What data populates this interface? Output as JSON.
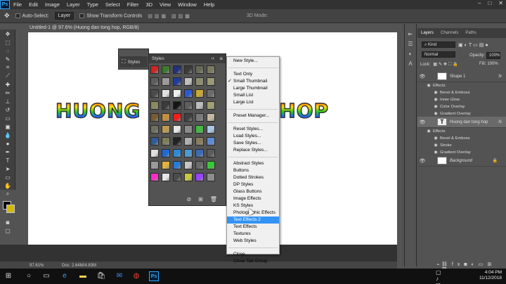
{
  "app": {
    "logo": "Ps"
  },
  "menubar": {
    "items": [
      "File",
      "Edit",
      "Image",
      "Layer",
      "Type",
      "Select",
      "Filter",
      "3D",
      "View",
      "Window",
      "Help"
    ]
  },
  "options": {
    "auto_select": "Auto-Select:",
    "auto_select_value": "Layer",
    "transform": "Show Transform Controls",
    "mode_label": "3D Mode:"
  },
  "document": {
    "tab": "Untitled-1 @ 97.6% (Huong dan tong hop, RGB/8) *",
    "headline": "HUONG DAN TONG HOP"
  },
  "status": {
    "zoom": "97.61%",
    "doc": "Doc: 2.64M/4.83M"
  },
  "styles_panel": {
    "title": "Styles",
    "mini_title": "Styles",
    "swatch_colors": [
      "#d52222",
      "#3a7a2e",
      "#23307a",
      "#3b3b3b",
      "#666b55",
      "#7a7a5c",
      "#5e5e5e",
      "#9b9b9b",
      "#1f3e9a",
      "#c0c0c0",
      "#8d8d6d",
      "#9a9a74",
      "#4a4a4a",
      "#e0e0e0",
      "#f0f0f0",
      "#2a5bd6",
      "#c8a833",
      "#6c6c6c",
      "#8a8a5e",
      "#3b3b3b",
      "#151515",
      "#5d5d5d",
      "#bdbdbd",
      "#a0a070",
      "#7b5a2f",
      "#c68d3f",
      "#ef1d1d",
      "#404040",
      "#7a7a7a",
      "#c4b9a0",
      "#707060",
      "#bd9b55",
      "#e6e6e6",
      "#8b8b8b",
      "#42b942",
      "#a8c8e8",
      "#2f5a9c",
      "#7e7e5c",
      "#222222",
      "#b0b0b0",
      "#8a7d5c",
      "#5d8ad6",
      "#e0e0e0",
      "#1d6ad6",
      "#2a8ad6",
      "#4a9ad6",
      "#3c6bb5",
      "#5b5b5b",
      "#9a9a9a",
      "#e0b33a",
      "#2a7ad6",
      "#c6c6c6",
      "#6a6a6a",
      "#34ca34",
      "#ff2bc9",
      "#e6e6e6",
      "#4b4b4b",
      "#c9c93a",
      "#9a44ff",
      "#8d8d8d"
    ]
  },
  "menu": {
    "items": [
      {
        "label": "New Style...",
        "sep_after": true
      },
      {
        "label": "Text Only"
      },
      {
        "label": "Small Thumbnail",
        "checked": true
      },
      {
        "label": "Large Thumbnail"
      },
      {
        "label": "Small List"
      },
      {
        "label": "Large List",
        "sep_after": true
      },
      {
        "label": "Preset Manager...",
        "sep_after": true
      },
      {
        "label": "Reset Styles..."
      },
      {
        "label": "Load Styles..."
      },
      {
        "label": "Save Styles..."
      },
      {
        "label": "Replace Styles...",
        "sep_after": true
      },
      {
        "label": "Abstract Styles"
      },
      {
        "label": "Buttons"
      },
      {
        "label": "Dotted Strokes"
      },
      {
        "label": "DP Styles"
      },
      {
        "label": "Glass Buttons"
      },
      {
        "label": "Image Effects"
      },
      {
        "label": "KS Styles"
      },
      {
        "label": "Photographic Effects"
      },
      {
        "label": "Text Effects 2",
        "highlighted": true
      },
      {
        "label": "Text Effects"
      },
      {
        "label": "Textures"
      },
      {
        "label": "Web Styles",
        "sep_after": true
      },
      {
        "label": "Close"
      },
      {
        "label": "Close Tab Group"
      }
    ]
  },
  "layers_panel": {
    "tabs": [
      "Layers",
      "Channels",
      "Paths"
    ],
    "kind": "Kind",
    "blend": "Normal",
    "opacity_label": "Opacity:",
    "opacity": "100%",
    "lock_label": "Lock:",
    "fill_label": "Fill:",
    "fill": "100%",
    "layers": [
      {
        "name": "Shape 1",
        "effects_label": "Effects",
        "effects": [
          "Bevel & Emboss",
          "Inner Glow",
          "Color Overlay",
          "Gradient Overlay"
        ]
      },
      {
        "name": "Huong dan tong hop",
        "effects_label": "Effects",
        "effects": [
          "Bevel & Emboss",
          "Stroke",
          "Gradient Overlay"
        ]
      },
      {
        "name": "Background"
      }
    ]
  },
  "taskbar": {
    "time": "4:04 PM",
    "date": "11/12/2018"
  }
}
